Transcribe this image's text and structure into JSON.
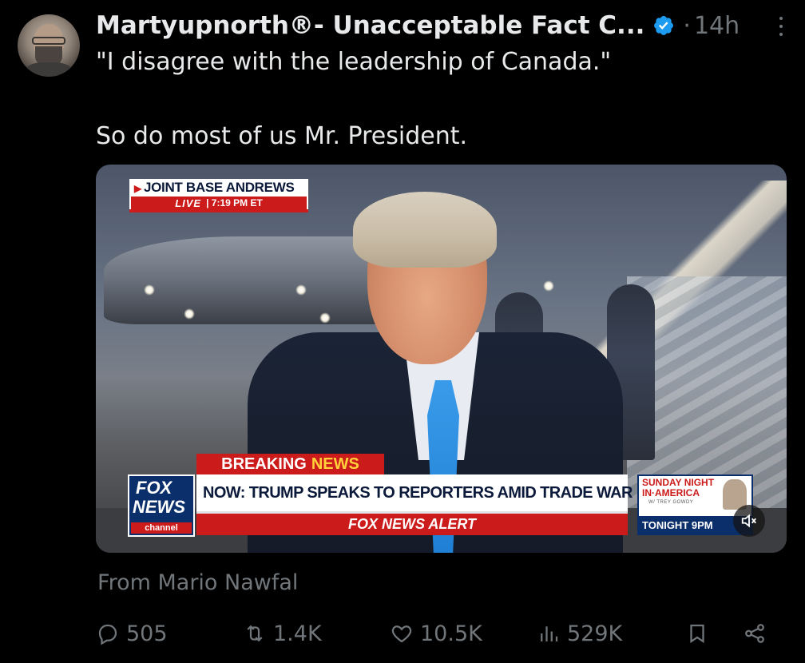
{
  "author": {
    "display_name": "Martyupnorth®- Unacceptable Fact C...",
    "verified_icon": "verified-badge-icon",
    "separator": "·",
    "time": "14h"
  },
  "tweet": {
    "line1": "\"I disagree with the leadership of Canada.\"",
    "line2": "So do most of us Mr. President."
  },
  "media": {
    "location": "JOINT BASE ANDREWS",
    "live_label": "LIVE",
    "live_time": "| 7:19 PM ET",
    "breaking": "BREAKING",
    "breaking_news": "NEWS",
    "headline": "NOW: TRUMP SPEAKS TO REPORTERS AMID TRADE WAR",
    "alert": "FOX NEWS ALERT",
    "logo_line1": "FOX",
    "logo_line2": "NEWS",
    "logo_line3": "channel",
    "promo_line1": "SUNDAY NIGHT",
    "promo_line2": "IN·AMERICA",
    "promo_line3": "W/ TREY GOWDY",
    "promo_tonight": "TONIGHT 9PM",
    "mute_icon": "speaker-muted-icon",
    "colors": {
      "fox_red": "#cc1b1b",
      "fox_blue": "#0b2f6b",
      "news_yellow": "#ffd23a"
    }
  },
  "attribution": "From Mario Nawfal",
  "actions": {
    "replies": "505",
    "reposts": "1.4K",
    "likes": "10.5K",
    "views": "529K"
  },
  "colors": {
    "background": "#000000",
    "text_primary": "#e7e9ea",
    "text_secondary": "#71767b",
    "verified_blue": "#1d9bf0"
  }
}
